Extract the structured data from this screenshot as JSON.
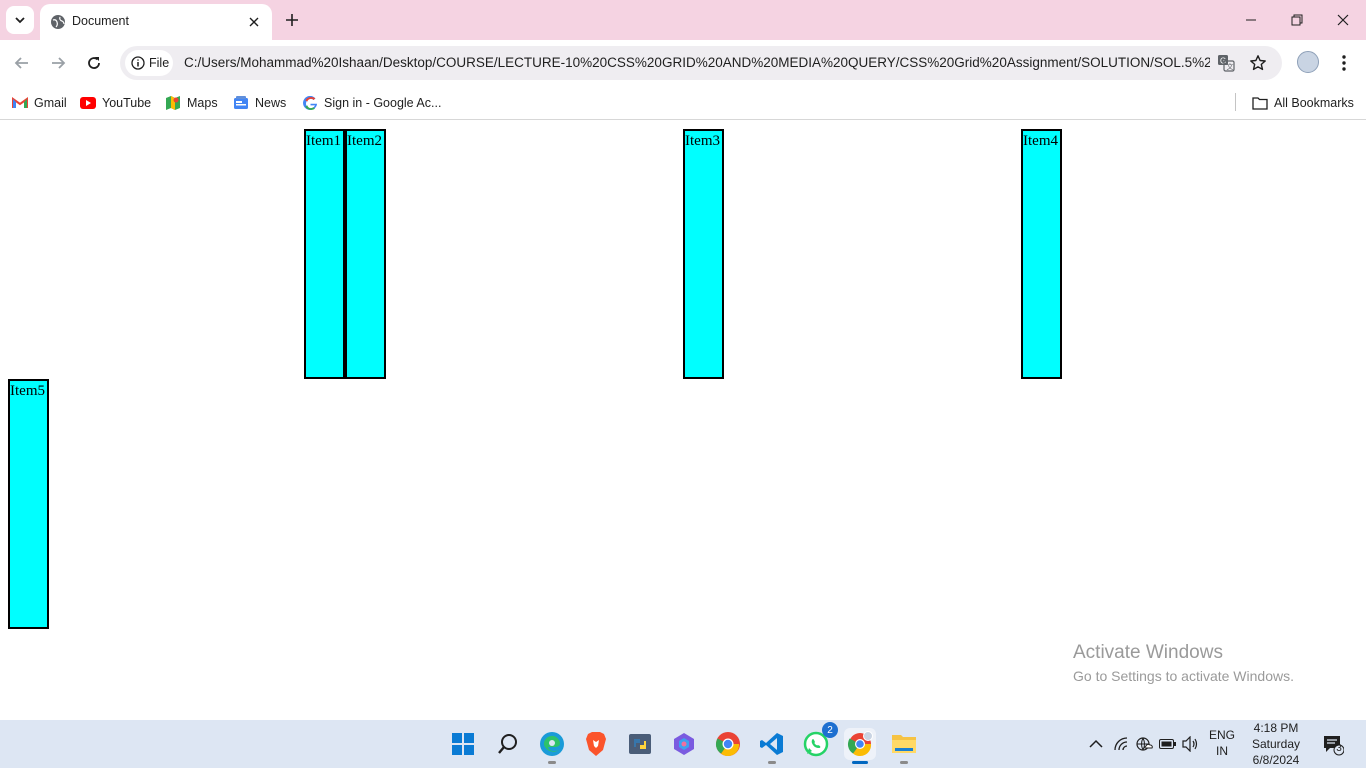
{
  "browser": {
    "tab_title": "Document",
    "address_chip": "File",
    "url": "C:/Users/Mohammad%20Ishaan/Desktop/COURSE/LECTURE-10%20CSS%20GRID%20AND%20MEDIA%20QUERY/CSS%20Grid%20Assignment/SOLUTION/SOL.5%20...",
    "bookmarks": [
      "Gmail",
      "YouTube",
      "Maps",
      "News",
      "Sign in - Google Ac..."
    ],
    "all_bookmarks": "All Bookmarks"
  },
  "page": {
    "items": [
      "Item1",
      "Item2",
      "Item3",
      "Item4",
      "Item5"
    ],
    "item_bg": "#00ffff"
  },
  "watermark": {
    "title": "Activate Windows",
    "subtitle": "Go to Settings to activate Windows."
  },
  "taskbar": {
    "whatsapp_badge": "2",
    "lang_line1": "ENG",
    "lang_line2": "IN",
    "time": "4:18 PM",
    "day": "Saturday",
    "date": "6/8/2024",
    "notifications": "3"
  }
}
